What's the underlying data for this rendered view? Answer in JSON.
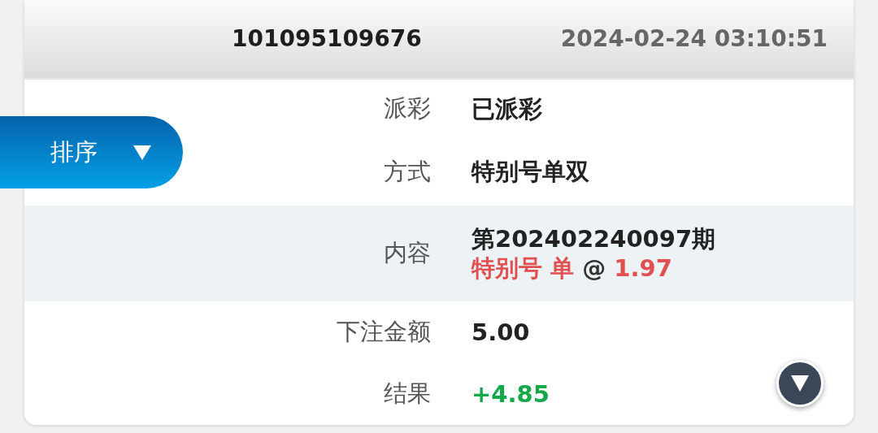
{
  "header": {
    "order_id": "101095109676",
    "time": "2024-02-24 03:10:51"
  },
  "rows": [
    {
      "label": "派彩",
      "kind": "text",
      "highlighted": false,
      "value": "已派彩"
    },
    {
      "label": "方式",
      "kind": "text",
      "highlighted": false,
      "value": "特别号单双"
    },
    {
      "label": "内容",
      "kind": "content",
      "highlighted": true,
      "value": "第202402240097期",
      "parts": [
        {
          "text": "特别号 单",
          "color": "#e05050"
        },
        {
          "text": "@",
          "color": "#333333"
        },
        {
          "text": "1.97",
          "color": "#e05050"
        }
      ]
    },
    {
      "label": "下注金额",
      "kind": "text",
      "highlighted": false,
      "value": "5.00"
    },
    {
      "label": "结果",
      "kind": "result",
      "highlighted": false,
      "value": "+4.85"
    }
  ],
  "sort_button": {
    "label": "排序"
  }
}
